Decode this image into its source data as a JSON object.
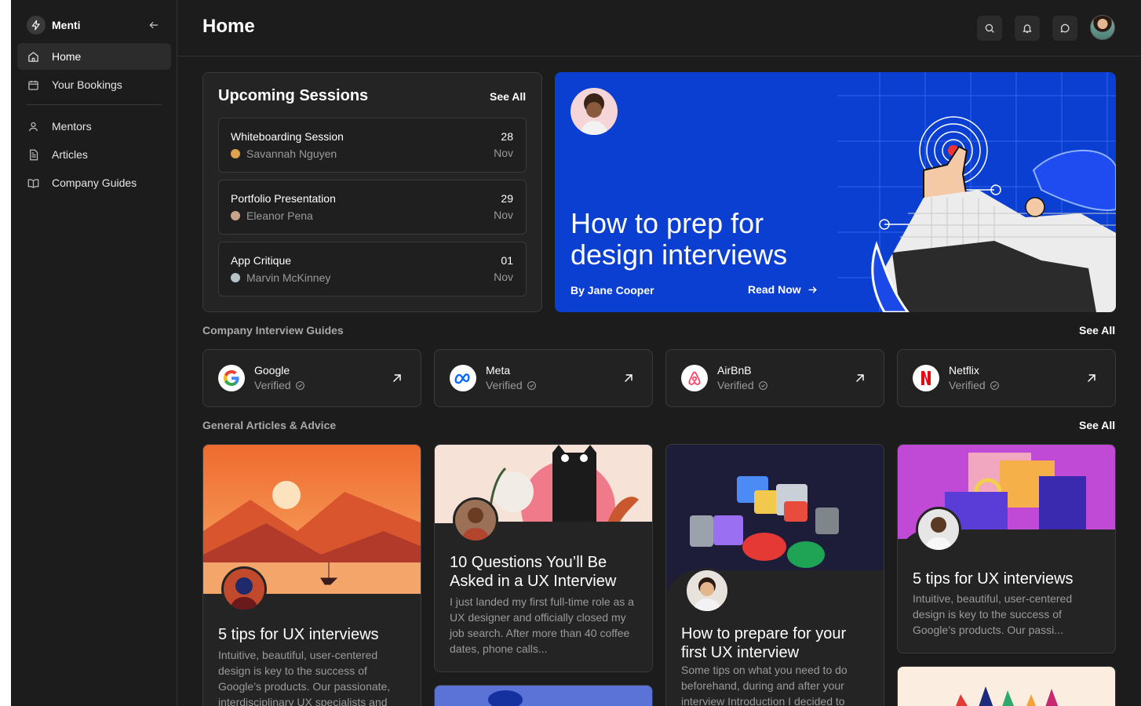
{
  "app": {
    "name": "Menti"
  },
  "sidebar": {
    "items": [
      {
        "label": "Home",
        "icon": "home-icon",
        "active": true
      },
      {
        "label": "Your Bookings",
        "icon": "calendar-icon"
      },
      {
        "label": "Mentors",
        "icon": "user-icon"
      },
      {
        "label": "Articles",
        "icon": "document-icon"
      },
      {
        "label": "Company Guides",
        "icon": "book-icon"
      }
    ]
  },
  "header": {
    "title": "Home",
    "icons": [
      "search-icon",
      "bell-icon",
      "chat-icon",
      "avatar"
    ]
  },
  "sessions": {
    "title": "Upcoming Sessions",
    "see_all": "See All",
    "items": [
      {
        "name": "Whiteboarding Session",
        "mentor": "Savannah Nguyen",
        "day": "28",
        "month": "Nov"
      },
      {
        "name": "Portfolio Presentation",
        "mentor": "Eleanor Pena",
        "day": "29",
        "month": "Nov"
      },
      {
        "name": "App Critique",
        "mentor": "Marvin McKinney",
        "day": "01",
        "month": "Nov"
      }
    ]
  },
  "hero": {
    "title": "How to prep for design interviews",
    "author": "By Jane Cooper",
    "cta": "Read Now",
    "background": "#0b3fd1"
  },
  "guides": {
    "title": "Company Interview Guides",
    "see_all": "See All",
    "items": [
      {
        "name": "Google",
        "status": "Verified",
        "logo": "google-logo"
      },
      {
        "name": "Meta",
        "status": "Verified",
        "logo": "meta-logo"
      },
      {
        "name": "AirBnB",
        "status": "Verified",
        "logo": "airbnb-logo"
      },
      {
        "name": "Netflix",
        "status": "Verified",
        "logo": "netflix-logo"
      }
    ]
  },
  "articles": {
    "title": "General Articles & Advice",
    "see_all": "See All",
    "items": [
      {
        "title": "5 tips for UX interviews",
        "excerpt": "Intuitive, beautiful, user-centered design is key to the success of Google’s products. Our passionate, interdisciplinary UX specialists and"
      },
      {
        "title": "10 Questions You’ll Be Asked in a UX Interview",
        "excerpt": "I just landed my first full-time role as a UX designer and officially closed my job search. After more than 40 coffee dates, phone calls..."
      },
      {
        "title": "How to prepare for your first UX interview",
        "excerpt": "Some tips on what you need to do beforehand, during and after your interview Introduction I decided to"
      },
      {
        "title": "5 tips for UX interviews",
        "excerpt": "Intuitive, beautiful, user-centered design is key to the success of Google’s products. Our passi..."
      }
    ]
  }
}
